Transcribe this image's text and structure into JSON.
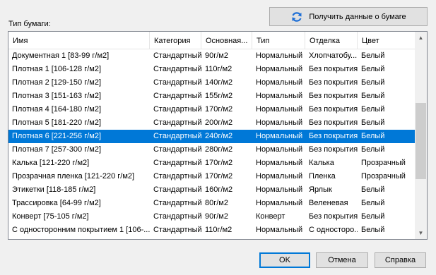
{
  "toolbar": {
    "get_info_label": "Получить данные о бумаге",
    "get_info_icon": "refresh-icon"
  },
  "paper_type_label": "Тип бумаги:",
  "columns": [
    "Имя",
    "Категория",
    "Основная...",
    "Тип",
    "Отделка",
    "Цвет"
  ],
  "rows": [
    [
      "Документная 1 [83-99 г/м2]",
      "Стандартный",
      "90г/м2",
      "Нормальный",
      "Хлопчатобу...",
      "Белый"
    ],
    [
      "Плотная 1 [106-128 г/м2]",
      "Стандартный",
      "110г/м2",
      "Нормальный",
      "Без покрытия",
      "Белый"
    ],
    [
      "Плотная 2 [129-150 г/м2]",
      "Стандартный",
      "140г/м2",
      "Нормальный",
      "Без покрытия",
      "Белый"
    ],
    [
      "Плотная 3 [151-163 г/м2]",
      "Стандартный",
      "155г/м2",
      "Нормальный",
      "Без покрытия",
      "Белый"
    ],
    [
      "Плотная 4 [164-180 г/м2]",
      "Стандартный",
      "170г/м2",
      "Нормальный",
      "Без покрытия",
      "Белый"
    ],
    [
      "Плотная 5 [181-220 г/м2]",
      "Стандартный",
      "200г/м2",
      "Нормальный",
      "Без покрытия",
      "Белый"
    ],
    [
      "Плотная 6 [221-256 г/м2]",
      "Стандартный",
      "240г/м2",
      "Нормальный",
      "Без покрытия",
      "Белый"
    ],
    [
      "Плотная 7 [257-300 г/м2]",
      "Стандартный",
      "280г/м2",
      "Нормальный",
      "Без покрытия",
      "Белый"
    ],
    [
      "Калька [121-220 г/м2]",
      "Стандартный",
      "170г/м2",
      "Нормальный",
      "Калька",
      "Прозрачный"
    ],
    [
      "Прозрачная пленка [121-220 г/м2]",
      "Стандартный",
      "170г/м2",
      "Нормальный",
      "Пленка",
      "Прозрачный"
    ],
    [
      "Этикетки [118-185 г/м2]",
      "Стандартный",
      "160г/м2",
      "Нормальный",
      "Ярлык",
      "Белый"
    ],
    [
      "Трассировка [64-99 г/м2]",
      "Стандартный",
      "80г/м2",
      "Нормальный",
      "Веленевая",
      "Белый"
    ],
    [
      "Конверт [75-105 г/м2]",
      "Стандартный",
      "90г/м2",
      "Конверт",
      "Без покрытия",
      "Белый"
    ],
    [
      "С односторонним покрытием 1 [106-...",
      "Стандартный",
      "110г/м2",
      "Нормальный",
      "С односторо...",
      "Белый"
    ]
  ],
  "selected_row": 6,
  "buttons": {
    "ok": "OK",
    "cancel": "Отмена",
    "help": "Справка"
  },
  "colors": {
    "selection": "#0078d7",
    "default_button_border": "#0078d7"
  }
}
